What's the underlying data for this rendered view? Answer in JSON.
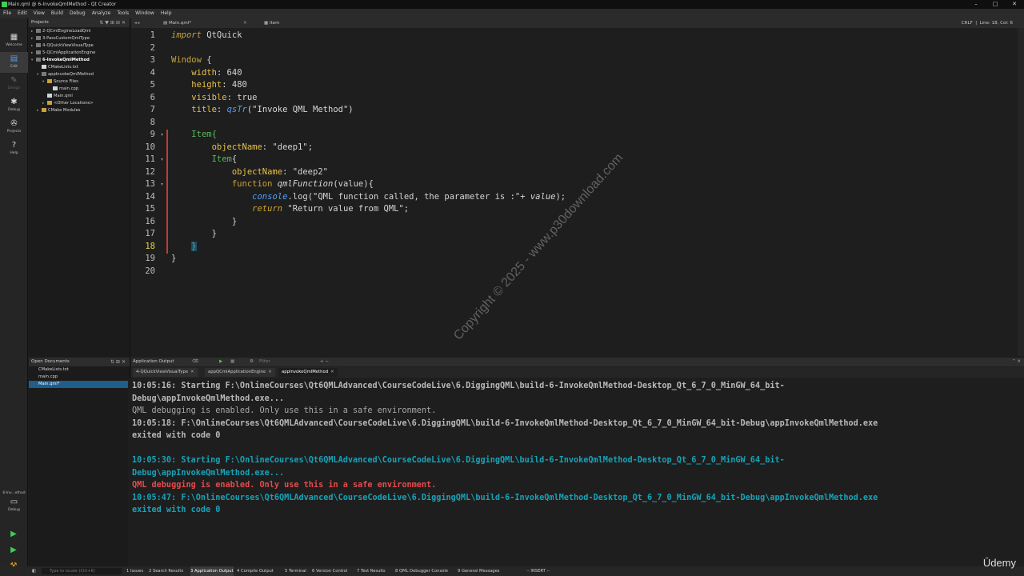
{
  "window": {
    "title": "Main.qml @ 6-InvokeQmlMethod - Qt Creator",
    "min": "–",
    "max": "□",
    "close": "✕"
  },
  "menu": [
    "File",
    "Edit",
    "View",
    "Build",
    "Debug",
    "Analyze",
    "Tools",
    "Window",
    "Help"
  ],
  "modes": [
    {
      "label": "Welcome",
      "icon": "grid-icon"
    },
    {
      "label": "Edit",
      "icon": "edit-icon"
    },
    {
      "label": "Design",
      "icon": "design-icon"
    },
    {
      "label": "Debug",
      "icon": "bug-icon"
    },
    {
      "label": "Projects",
      "icon": "wrench-icon"
    },
    {
      "label": "Help",
      "icon": "help-icon"
    }
  ],
  "kit": {
    "name": "6-Inv...ethod",
    "mode": "Debug"
  },
  "projects": {
    "title": "Projects",
    "items": [
      {
        "label": "2-QCmlEngineLoadQml",
        "type": "proj",
        "level": 0,
        "arrow": "▸"
      },
      {
        "label": "3-PassCustomQmlType",
        "type": "proj",
        "level": 0,
        "arrow": "▸"
      },
      {
        "label": "4-QQuickViewVisualType",
        "type": "proj",
        "level": 0,
        "arrow": "▸"
      },
      {
        "label": "5-QCmlApplicationEngine",
        "type": "proj",
        "level": 0,
        "arrow": "▸"
      },
      {
        "label": "6-InvokeQmlMethod",
        "type": "proj",
        "level": 0,
        "arrow": "▾",
        "bold": true
      },
      {
        "label": "CMakeLists.txt",
        "type": "file",
        "level": 1,
        "arrow": ""
      },
      {
        "label": "appInvokeQmlMethod",
        "type": "proj",
        "level": 1,
        "arrow": "▾"
      },
      {
        "label": "Source Files",
        "type": "fold",
        "level": 2,
        "arrow": "▾"
      },
      {
        "label": "main.cpp",
        "type": "file",
        "level": 3,
        "arrow": ""
      },
      {
        "label": "Main.qml",
        "type": "file",
        "level": 2,
        "arrow": ""
      },
      {
        "label": "<Other Locations>",
        "type": "fold",
        "level": 2,
        "arrow": "▸"
      },
      {
        "label": "CMake Modules",
        "type": "fold",
        "level": 1,
        "arrow": "▸"
      }
    ]
  },
  "open_documents": {
    "title": "Open Documents",
    "items": [
      "CMakeLists.txt",
      "main.cpp",
      "Main.qml*"
    ],
    "selected_index": 2
  },
  "editor_toolbar": {
    "file": "Main.qml*",
    "symbol": "Item",
    "encoding": "CRLF",
    "position": "Line: 18, Col: 6"
  },
  "code": {
    "current_line": 18,
    "lines": [
      [
        [
          "import",
          "kwi"
        ],
        [
          " QtQuick",
          ""
        ]
      ],
      [],
      [
        [
          "Window",
          "typ"
        ],
        [
          " {",
          ""
        ]
      ],
      [
        [
          "    ",
          ""
        ],
        [
          "width",
          "prop"
        ],
        [
          ": 640",
          ""
        ]
      ],
      [
        [
          "    ",
          ""
        ],
        [
          "height",
          "prop"
        ],
        [
          ": 480",
          ""
        ]
      ],
      [
        [
          "    ",
          ""
        ],
        [
          "visible",
          "prop"
        ],
        [
          ": true",
          ""
        ]
      ],
      [
        [
          "    ",
          ""
        ],
        [
          "title",
          "prop"
        ],
        [
          ": ",
          ""
        ],
        [
          "qsTr",
          "bluei"
        ],
        [
          "(\"Invoke QML Method\")",
          "str"
        ]
      ],
      [],
      [
        [
          "    ",
          ""
        ],
        [
          "Item",
          "itm"
        ],
        [
          "{",
          "itm"
        ]
      ],
      [
        [
          "        ",
          ""
        ],
        [
          "objectName",
          "prop"
        ],
        [
          ": \"deep1\";",
          ""
        ]
      ],
      [
        [
          "        ",
          ""
        ],
        [
          "Item",
          "itm"
        ],
        [
          "{",
          ""
        ]
      ],
      [
        [
          "            ",
          ""
        ],
        [
          "objectName",
          "prop"
        ],
        [
          ": \"deep2\"",
          ""
        ]
      ],
      [
        [
          "            ",
          ""
        ],
        [
          "function",
          "kw"
        ],
        [
          " ",
          ""
        ],
        [
          "qmlFunction",
          "fnc"
        ],
        [
          "(value){",
          ""
        ]
      ],
      [
        [
          "                ",
          ""
        ],
        [
          "console",
          "cons"
        ],
        [
          ".log(\"QML function called, the parameter is :\"+ ",
          ""
        ],
        [
          "value",
          "val"
        ],
        [
          ");",
          ""
        ]
      ],
      [
        [
          "                ",
          ""
        ],
        [
          "return",
          "kwi"
        ],
        [
          " \"Return value from QML\";",
          ""
        ]
      ],
      [
        [
          "            }",
          ""
        ]
      ],
      [
        [
          "        }",
          ""
        ]
      ],
      [
        [
          "    ",
          ""
        ],
        [
          "}",
          "curbrace"
        ]
      ],
      [
        [
          "}",
          ""
        ]
      ],
      []
    ]
  },
  "watermark": "Copyright © 2025 - www.p30download.com",
  "output": {
    "title": "Application Output",
    "filter_placeholder": "Filter",
    "tabs": [
      {
        "label": "4-QQuickViewVisualType",
        "close": "✕"
      },
      {
        "label": "appQCmlApplicationEngine",
        "close": "✕"
      },
      {
        "label": "appInvokeQmlMethod",
        "close": "✕"
      }
    ],
    "active_tab": 2,
    "lines": [
      {
        "text": "10:05:16: Starting F:\\OnlineCourses\\Qt6QMLAdvanced\\CourseCodeLive\\6.DiggingQML\\build-6-InvokeQmlMethod-Desktop_Qt_6_7_0_MinGW_64_bit-",
        "style": "gray"
      },
      {
        "text": "Debug\\appInvokeQmlMethod.exe...",
        "style": "gray"
      },
      {
        "text": "QML debugging is enabled. Only use this in a safe environment.",
        "style": "grayn"
      },
      {
        "text": "10:05:18: F:\\OnlineCourses\\Qt6QMLAdvanced\\CourseCodeLive\\6.DiggingQML\\build-6-InvokeQmlMethod-Desktop_Qt_6_7_0_MinGW_64_bit-Debug\\appInvokeQmlMethod.exe",
        "style": "gray"
      },
      {
        "text": "exited with code 0",
        "style": "gray"
      },
      {
        "text": "",
        "style": "gray"
      },
      {
        "text": "10:05:30: Starting F:\\OnlineCourses\\Qt6QMLAdvanced\\CourseCodeLive\\6.DiggingQML\\build-6-InvokeQmlMethod-Desktop_Qt_6_7_0_MinGW_64_bit-",
        "style": "teal"
      },
      {
        "text": "Debug\\appInvokeQmlMethod.exe...",
        "style": "teal"
      },
      {
        "text": "QML debugging is enabled. Only use this in a safe environment.",
        "style": "red"
      },
      {
        "text": "10:05:47: F:\\OnlineCourses\\Qt6QMLAdvanced\\CourseCodeLive\\6.DiggingQML\\build-6-InvokeQmlMethod-Desktop_Qt_6_7_0_MinGW_64_bit-Debug\\appInvokeQmlMethod.exe",
        "style": "teal"
      },
      {
        "text": "exited with code 0",
        "style": "teal"
      }
    ]
  },
  "statusbar": {
    "locator_placeholder": "Type to locate (Ctrl+K)",
    "tabs": [
      "1 Issues",
      "2 Search Results",
      "3 Application Output",
      "4 Compile Output",
      "5 Terminal",
      "6 Version Control",
      "7 Test Results",
      "8 QML Debugger Console",
      "9 General Messages"
    ],
    "mode": "-- INSERT --"
  },
  "brand": "Ūdemy",
  "colors": {
    "accent": "#4aa3ff",
    "qt_green": "#41cd52",
    "error_red": "#e54b4b",
    "teal": "#17a2b8",
    "selection": "#1f5d8a"
  }
}
